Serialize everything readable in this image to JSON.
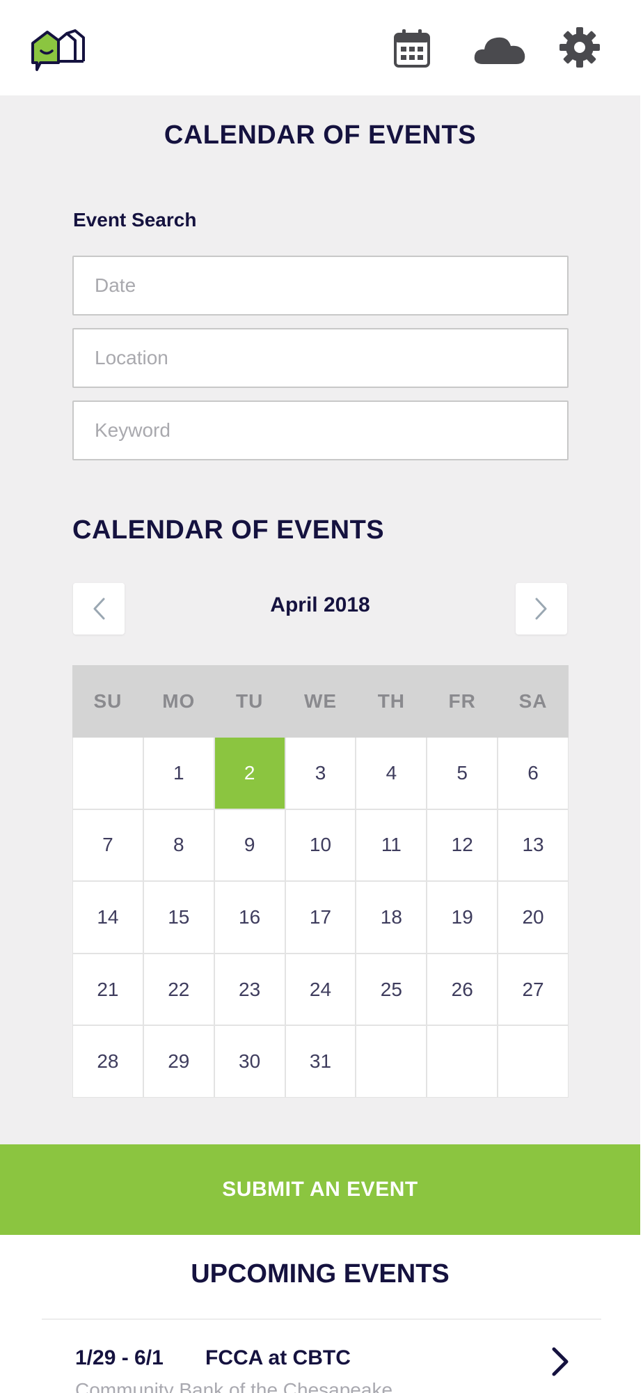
{
  "header": {
    "icons": [
      "app-logo",
      "calendar-icon",
      "cloud-icon",
      "gear-icon"
    ],
    "brand_color": "#8bc540"
  },
  "page": {
    "title": "CALENDAR OF EVENTS"
  },
  "search": {
    "label": "Event Search",
    "date_placeholder": "Date",
    "location_placeholder": "Location",
    "keyword_placeholder": "Keyword"
  },
  "calendar": {
    "title": "CALENDAR OF EVENTS",
    "month": "April 2018",
    "weekdays": [
      "SU",
      "MO",
      "TU",
      "WE",
      "TH",
      "FR",
      "SA"
    ],
    "cells": [
      "",
      "1",
      "2",
      "3",
      "4",
      "5",
      "6",
      "7",
      "8",
      "9",
      "10",
      "11",
      "12",
      "13",
      "14",
      "15",
      "16",
      "17",
      "18",
      "19",
      "20",
      "21",
      "22",
      "23",
      "24",
      "25",
      "26",
      "27",
      "28",
      "29",
      "30",
      "31",
      "",
      "",
      ""
    ],
    "selected_day": "2",
    "selected_color": "#8bc540"
  },
  "submit": {
    "label": "SUBMIT AN EVENT"
  },
  "upcoming": {
    "title": "UPCOMING EVENTS",
    "events": [
      {
        "date": "1/29 - 6/1",
        "name": "FCCA at CBTC",
        "subtitle": "Community Bank of the Chesapeake"
      }
    ]
  }
}
